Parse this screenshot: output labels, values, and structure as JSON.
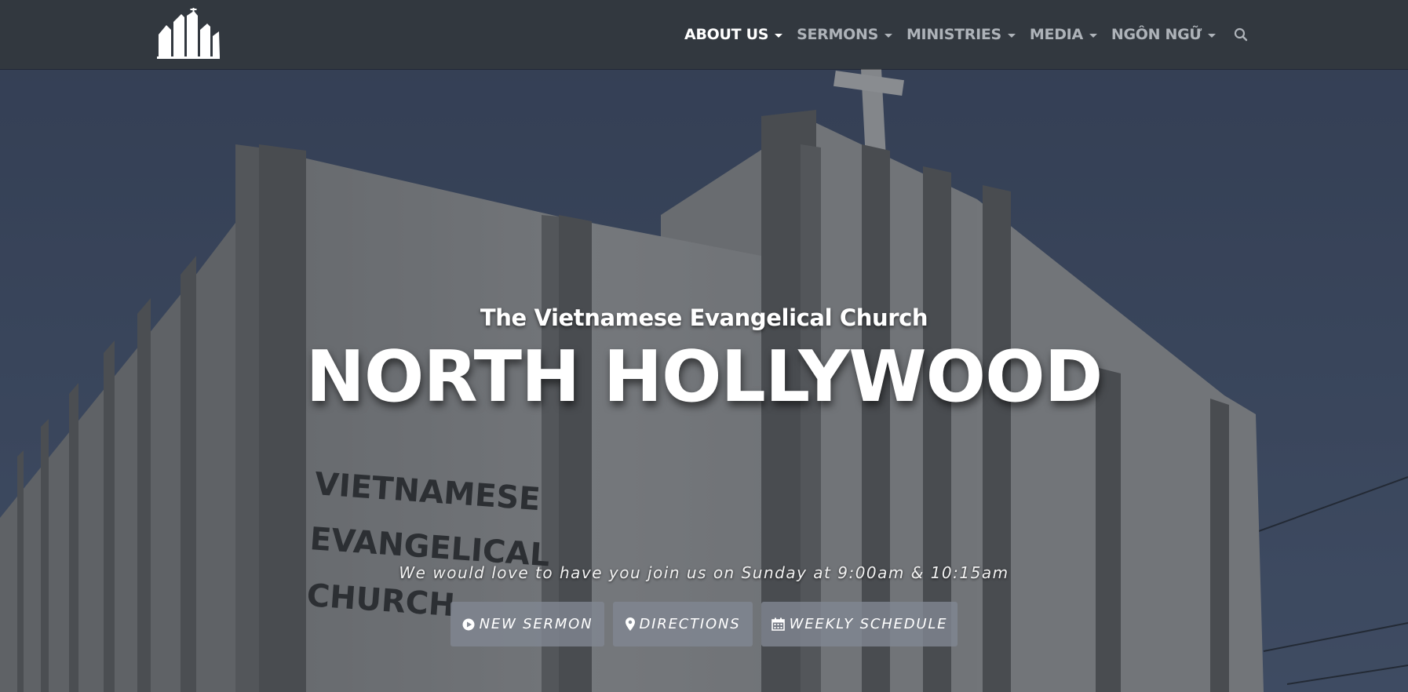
{
  "nav": {
    "items": [
      {
        "label": "ABOUT US",
        "active": true
      },
      {
        "label": "SERMONS",
        "active": false
      },
      {
        "label": "MINISTRIES",
        "active": false
      },
      {
        "label": "MEDIA",
        "active": false
      },
      {
        "label": "NGÔN NGỮ",
        "active": false
      }
    ],
    "search_icon": "search-icon",
    "logo_icon": "church-buildings-logo"
  },
  "hero": {
    "subtitle": "The Vietnamese Evangelical Church",
    "title": "NORTH HOLLYWOOD",
    "invite": "We would love to have you join us on Sunday at 9:00am & 10:15am",
    "wall_sign": [
      "VIETNAMESE",
      "EVANGELICAL",
      "CHURCH"
    ],
    "buttons": {
      "sermon": {
        "label": "NEW SERMON",
        "icon": "play-circle-icon"
      },
      "directions": {
        "label": "DIRECTIONS",
        "icon": "map-marker-icon"
      },
      "schedule": {
        "label": "WEEKLY SCHEDULE",
        "icon": "calendar-icon"
      }
    }
  },
  "colors": {
    "navbar": "#32383f",
    "nav_text": "#aeb3b9",
    "nav_active": "#ffffff",
    "sky": "#3d4a66",
    "button_bg": "#808691"
  }
}
